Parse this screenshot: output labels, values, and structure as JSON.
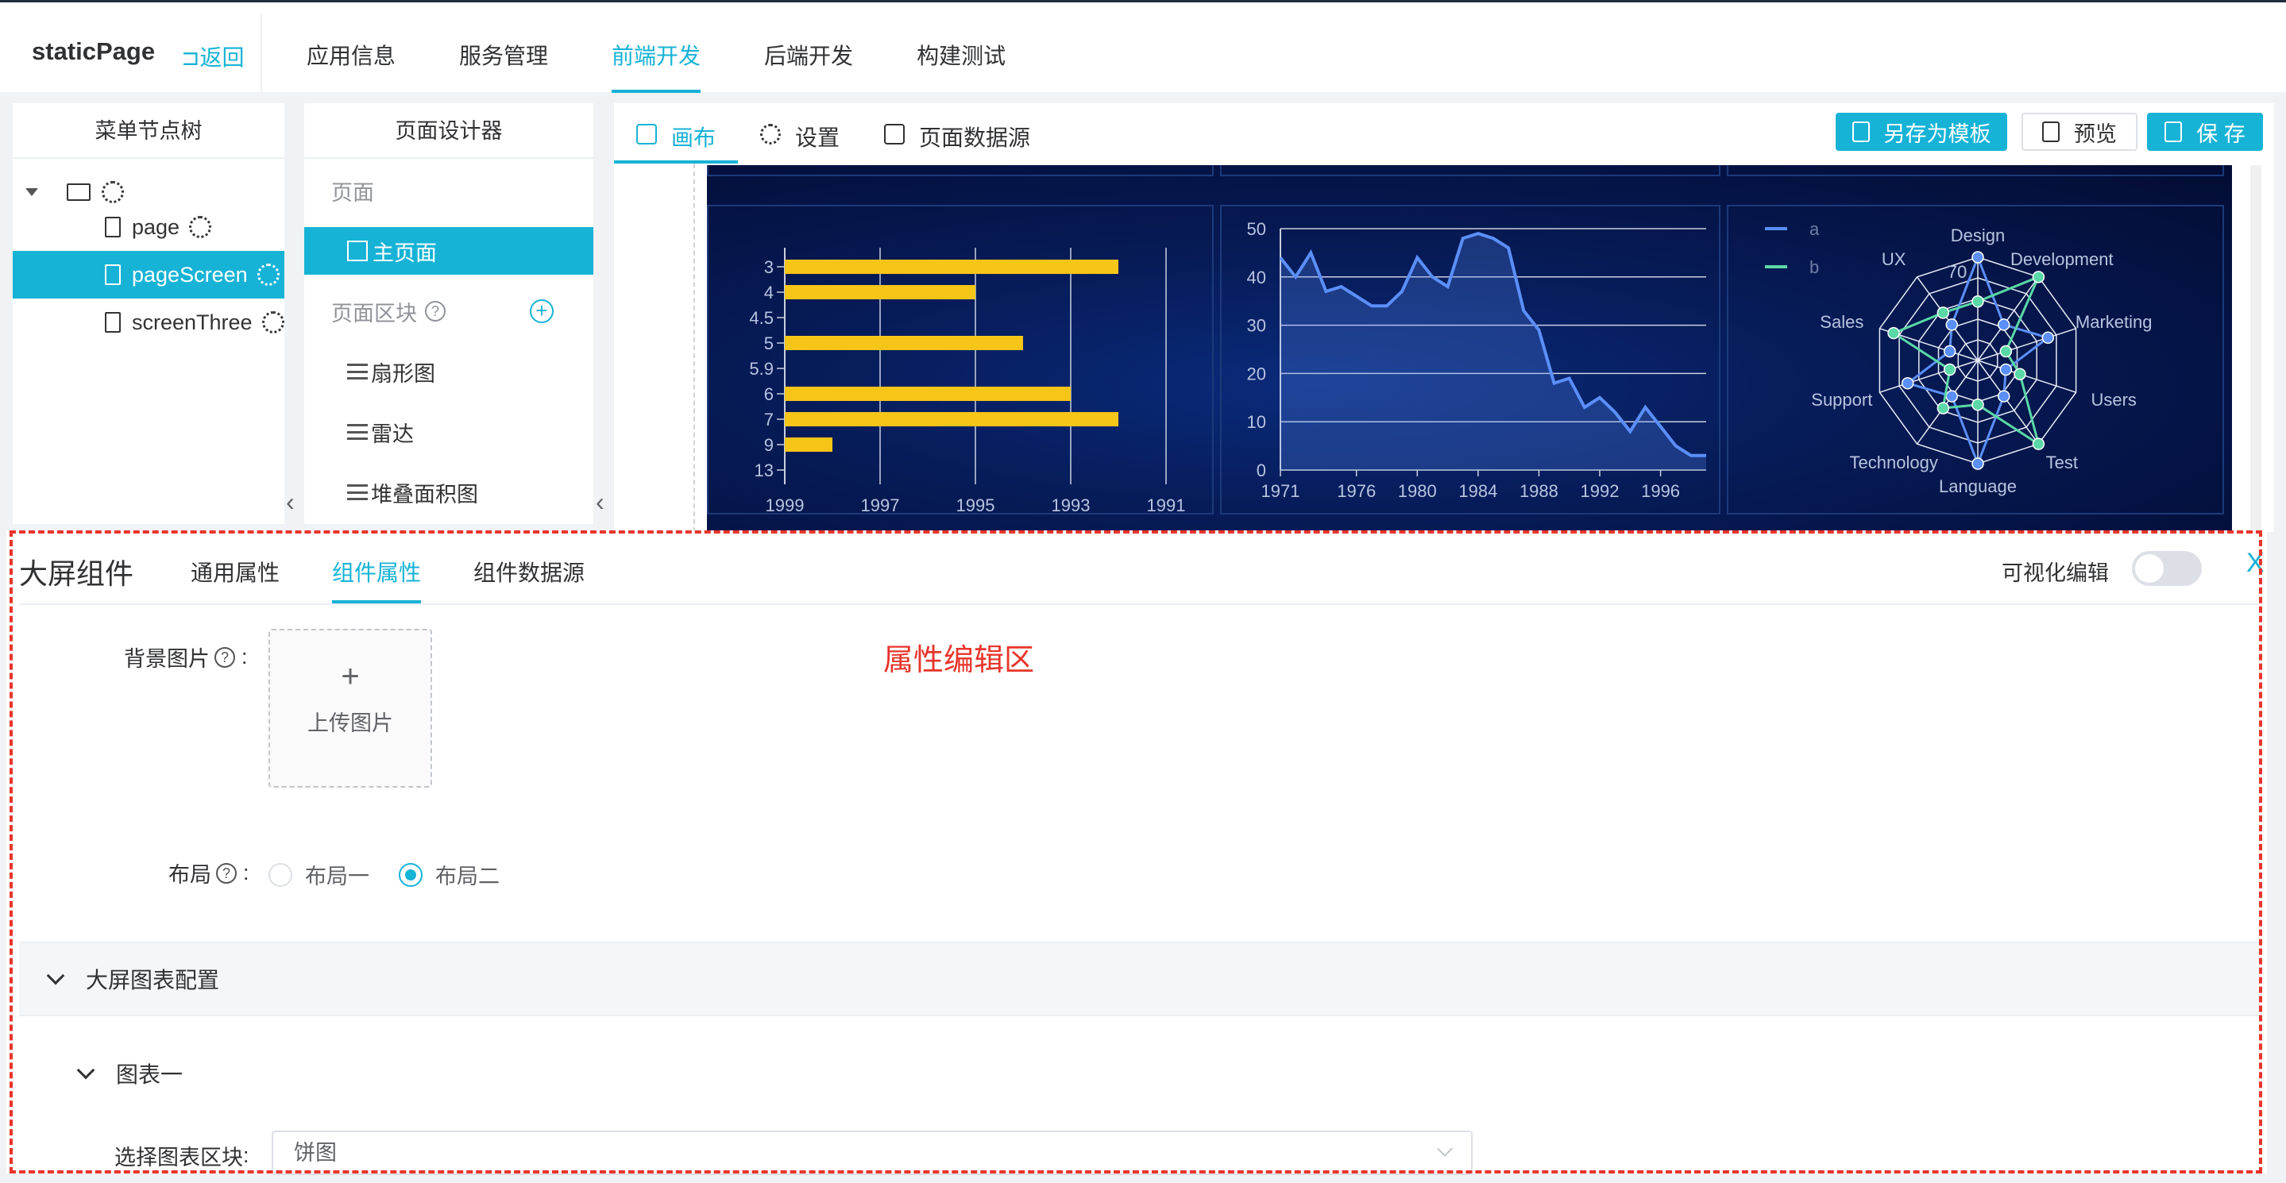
{
  "app": {
    "name": "staticPage",
    "back_label": "返回"
  },
  "nav": [
    "应用信息",
    "服务管理",
    "前端开发",
    "后端开发",
    "构建测试"
  ],
  "tree": {
    "title": "菜单节点树",
    "items": [
      "page",
      "pageScreen",
      "screenThree"
    ]
  },
  "designer": {
    "title": "页面设计器",
    "page_section": "页面",
    "main_page": "主页面",
    "block_section": "页面区块",
    "blocks": [
      "扇形图",
      "雷达",
      "堆叠面积图"
    ]
  },
  "canvas_tabs": [
    "画布",
    "设置",
    "页面数据源"
  ],
  "buttons": {
    "save_template": "另存为模板",
    "preview": "预览",
    "save": "保 存"
  },
  "chart_data": [
    {
      "type": "bar",
      "categories": [
        "3",
        "4",
        "4.5",
        "5",
        "5.9",
        "6",
        "7",
        "9",
        "13"
      ],
      "values": [
        1992,
        1995,
        null,
        1994,
        null,
        1993,
        1992,
        1998,
        null
      ],
      "xlim": [
        1999,
        1991
      ],
      "x_ticks": [
        "1999",
        "1997",
        "1995",
        "1993",
        "1991"
      ],
      "color": "#f5c518"
    },
    {
      "type": "area",
      "x_ticks": [
        "1971",
        "1976",
        "1980",
        "1984",
        "1988",
        "1992",
        "1996"
      ],
      "y_ticks": [
        "0",
        "10",
        "20",
        "30",
        "40",
        "50"
      ],
      "ylim": [
        0,
        50
      ],
      "x": [
        1971,
        1972,
        1973,
        1974,
        1975,
        1976,
        1977,
        1978,
        1979,
        1980,
        1981,
        1982,
        1983,
        1984,
        1985,
        1986,
        1987,
        1988,
        1989,
        1990,
        1991,
        1992,
        1993,
        1994,
        1995,
        1996,
        1997,
        1998,
        1999
      ],
      "y": [
        44,
        40,
        45,
        37,
        38,
        36,
        34,
        34,
        37,
        44,
        40,
        38,
        48,
        49,
        48,
        46,
        33,
        29,
        18,
        19,
        13,
        15,
        12,
        8,
        13,
        9,
        5,
        3,
        3
      ],
      "color": "#5b8ff9"
    },
    {
      "type": "radar",
      "indicators": [
        "Design",
        "Development",
        "Marketing",
        "Users",
        "Test",
        "Language",
        "Technology",
        "Support",
        "Sales",
        "UX"
      ],
      "tick_label": "70",
      "series": [
        {
          "name": "a",
          "values": [
            70,
            30,
            50,
            20,
            30,
            70,
            30,
            50,
            20,
            30
          ],
          "color": "#5b8ff9"
        },
        {
          "name": "b",
          "values": [
            40,
            70,
            20,
            30,
            70,
            30,
            40,
            20,
            60,
            40
          ],
          "color": "#5ad8a6"
        }
      ]
    }
  ],
  "props": {
    "title": "大屏组件",
    "tabs": [
      "通用属性",
      "组件属性",
      "组件数据源"
    ],
    "visual_edit_label": "可视化编辑",
    "close": "X",
    "bg_label": "背景图片",
    "upload_label": "上传图片",
    "note": "属性编辑区",
    "layout_label": "布局",
    "layout_options": [
      "布局一",
      "布局二"
    ],
    "chart_config": "大屏图表配置",
    "chart_one": "图表一",
    "select_label": "选择图表区块",
    "select_value": "饼图"
  }
}
